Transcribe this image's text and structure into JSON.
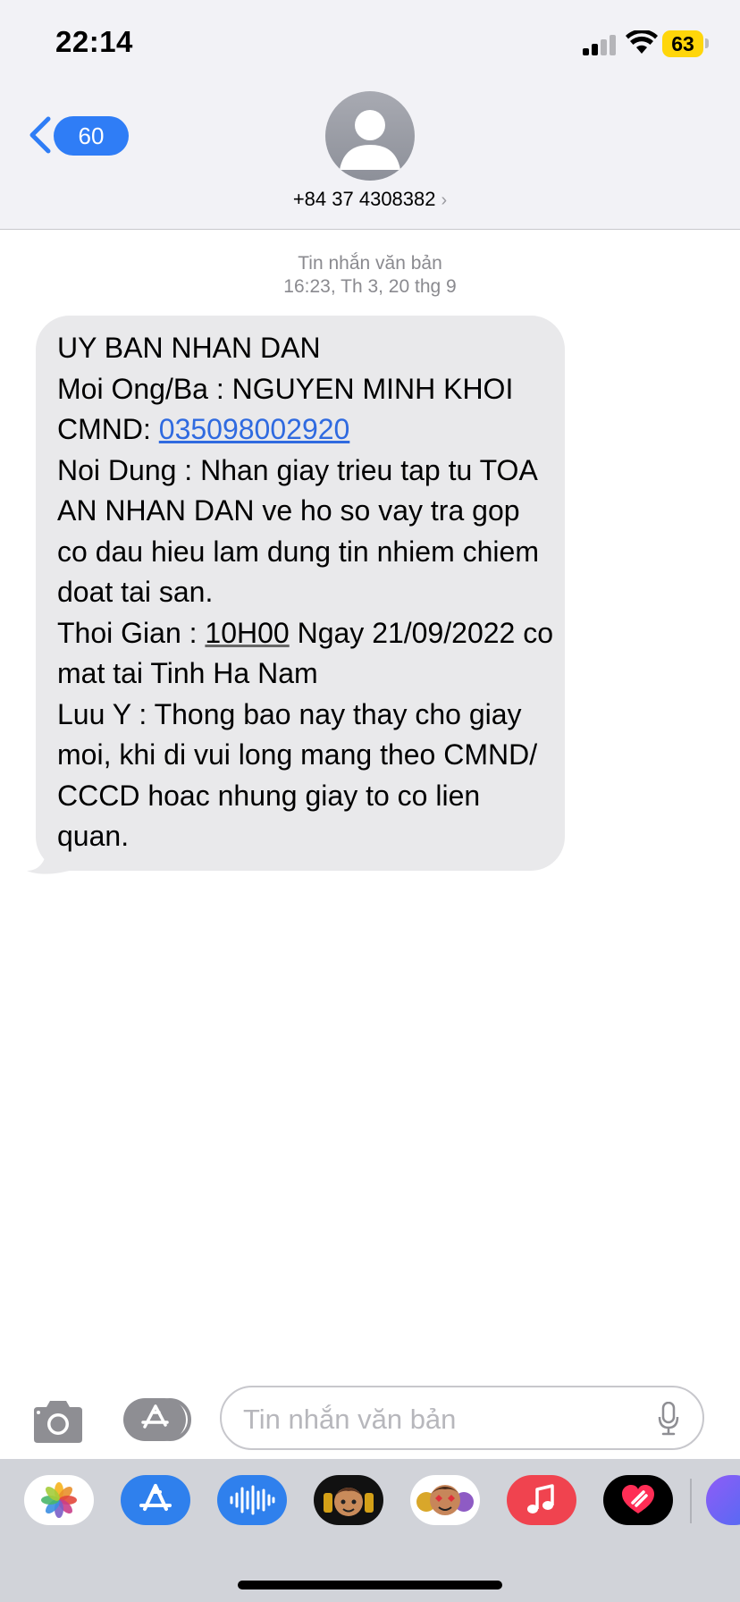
{
  "status_bar": {
    "time": "22:14",
    "battery": "63"
  },
  "nav": {
    "back_count": "60",
    "contact": "+84 37 4308382",
    "contact_chevron": "›"
  },
  "thread": {
    "type_label": "Tin nhắn văn bản",
    "timestamp": "16:23, Th 3, 20 thg 9"
  },
  "message": {
    "l1": "UY BAN NHAN DAN",
    "l2": "Moi Ong/Ba : NGUYEN MINH KHOI",
    "l3_prefix": "CMND: ",
    "l3_link": "035098002920",
    "l4": "Noi Dung : Nhan giay trieu tap tu TOA AN NHAN DAN ve ho so vay tra gop co dau hieu lam dung tin nhiem chiem doat tai san.",
    "l5_prefix": "Thoi Gian : ",
    "l5_time": "10H00",
    "l5_suffix": " Ngay 21/09/2022 co mat tai Tinh Ha Nam",
    "l6": "Luu Y : Thong bao nay thay cho giay moi, khi di vui long mang theo CMND/ CCCD hoac nhung giay to co lien quan."
  },
  "composer": {
    "placeholder": "Tin nhắn văn bản"
  },
  "app_drawer": {
    "apps": [
      "photos-icon",
      "app-store-icon",
      "audio-message-icon",
      "memoji-icon",
      "animoji-icon",
      "music-icon",
      "digital-touch-icon"
    ]
  },
  "colors": {
    "accent": "#2f7df6",
    "bubble": "#e9e9eb",
    "battery": "#ffd60a",
    "header": "#f2f2f6"
  }
}
